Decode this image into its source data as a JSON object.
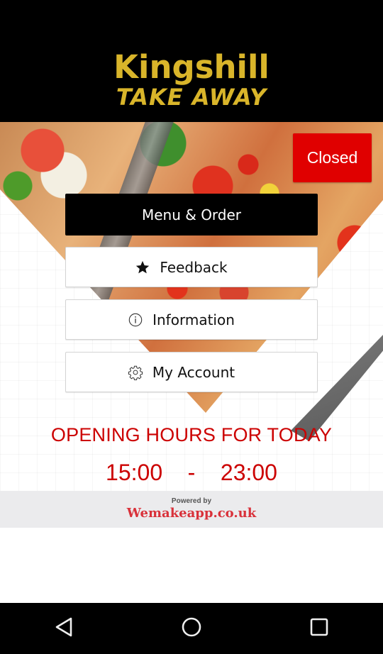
{
  "header": {
    "logo_line1": "Kingshill",
    "logo_line2": "TAKE AWAY"
  },
  "status": {
    "badge": "Closed",
    "badge_color": "#e00000"
  },
  "menu": {
    "primary": {
      "label": "Menu & Order"
    },
    "items": [
      {
        "label": "Feedback",
        "icon": "star-icon"
      },
      {
        "label": "Information",
        "icon": "info-icon"
      },
      {
        "label": "My Account",
        "icon": "gear-icon"
      }
    ]
  },
  "hours": {
    "title": "OPENING HOURS FOR TODAY",
    "open": "15:00",
    "separator": "-",
    "close": "23:00",
    "color": "#cc0000"
  },
  "footer": {
    "powered_label": "Powered by",
    "brand": "Wemakeapp.co.uk"
  },
  "nav": {
    "back": "back-icon",
    "home": "home-icon",
    "recents": "recents-icon"
  }
}
